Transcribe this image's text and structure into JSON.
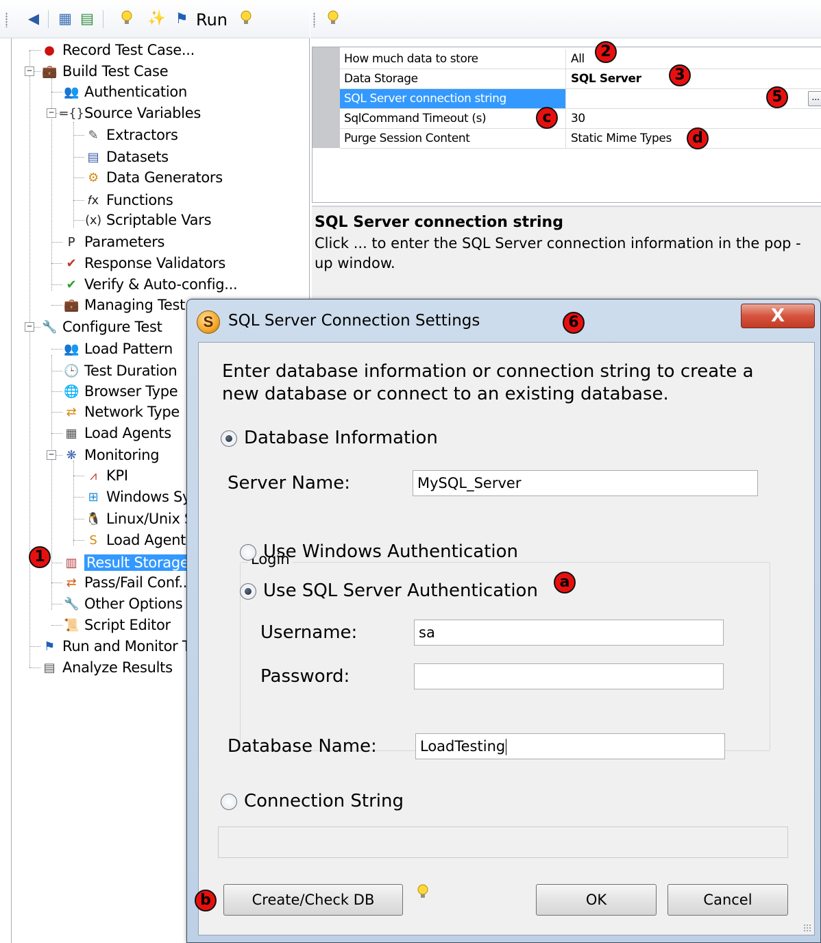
{
  "left_toolbar": {
    "buttons": [
      {
        "name": "back-icon",
        "glyph": "◆"
      },
      {
        "name": "grid-view-icon",
        "glyph": "▦"
      },
      {
        "name": "list-view-icon",
        "glyph": "▤"
      },
      {
        "name": "lightbulb-icon",
        "glyph": "💡"
      },
      {
        "name": "wand-icon",
        "glyph": "✨"
      },
      {
        "name": "flag-icon",
        "glyph": "⚑"
      }
    ],
    "run_label": "Run"
  },
  "tree": {
    "items": [
      {
        "label": "Record Test Case...",
        "icon": "record-icon",
        "glyph": "●",
        "color": "#cc1111"
      },
      {
        "label": "Build Test Case",
        "icon": "briefcase-icon",
        "glyph": "💼",
        "color": "#333333"
      },
      {
        "label": "Authentication",
        "icon": "users-icon",
        "glyph": "👥",
        "color": "#b7772a"
      },
      {
        "label": "Source Variables",
        "icon": "braces-icon",
        "glyph": "={}",
        "color": "#333333"
      },
      {
        "label": "Extractors",
        "icon": "pen-icon",
        "glyph": "✎",
        "color": "#555555"
      },
      {
        "label": "Datasets",
        "icon": "dataset-icon",
        "glyph": "▤",
        "color": "#3a5fa8"
      },
      {
        "label": "Data Generators",
        "icon": "generator-icon",
        "glyph": "⚙",
        "color": "#d48a12"
      },
      {
        "label": "Functions",
        "icon": "function-icon",
        "glyph": "𝑓x",
        "color": "#222222"
      },
      {
        "label": "Scriptable Vars",
        "icon": "variable-icon",
        "glyph": "(x)",
        "color": "#222222"
      },
      {
        "label": "Parameters",
        "icon": "parameter-icon",
        "glyph": "P",
        "color": "#222222"
      },
      {
        "label": "Response Validators",
        "icon": "validator-icon",
        "glyph": "✔",
        "color": "#c0392b"
      },
      {
        "label": "Verify & Auto-config...",
        "icon": "check-icon",
        "glyph": "✔",
        "color": "#2e9e2e"
      },
      {
        "label": "Managing Test Cases",
        "icon": "folder-icon",
        "glyph": "💼",
        "color": "#333333"
      },
      {
        "label": "Configure Test",
        "icon": "wrench-icon",
        "glyph": "🔧",
        "color": "#333333"
      },
      {
        "label": "Load Pattern",
        "icon": "load-pattern-icon",
        "glyph": "👥",
        "color": "#b33a3a"
      },
      {
        "label": "Test Duration",
        "icon": "clock-icon",
        "glyph": "🕒",
        "color": "#1f5fb8"
      },
      {
        "label": "Browser Type",
        "icon": "globe-icon",
        "glyph": "🌐",
        "color": "#1f5fb8"
      },
      {
        "label": "Network Type",
        "icon": "network-icon",
        "glyph": "⇄",
        "color": "#d48a12"
      },
      {
        "label": "Load Agents",
        "icon": "agents-icon",
        "glyph": "▦",
        "color": "#555555"
      },
      {
        "label": "Monitoring",
        "icon": "monitoring-icon",
        "glyph": "❋",
        "color": "#3a5fa8"
      },
      {
        "label": "KPI",
        "icon": "kpi-icon",
        "glyph": "⩘",
        "color": "#c0392b"
      },
      {
        "label": "Windows Systems",
        "icon": "windows-icon",
        "glyph": "⊞",
        "color": "#1f8fd8"
      },
      {
        "label": "Linux/Unix Systems",
        "icon": "linux-icon",
        "glyph": "🐧",
        "color": "#222222"
      },
      {
        "label": "Load Agents",
        "icon": "load-agent-icon",
        "glyph": "S",
        "color": "#d48a12"
      },
      {
        "label": "Result Storage",
        "icon": "storage-icon",
        "glyph": "▥",
        "color": "#b33a3a"
      },
      {
        "label": "Pass/Fail Conf...",
        "icon": "pass-fail-icon",
        "glyph": "⇄",
        "color": "#d45b12"
      },
      {
        "label": "Other Options",
        "icon": "options-icon",
        "glyph": "🔧",
        "color": "#333333"
      },
      {
        "label": "Script Editor",
        "icon": "script-icon",
        "glyph": "📜",
        "color": "#8a6a2a"
      },
      {
        "label": "Run and Monitor Test",
        "icon": "run-flag-icon",
        "glyph": "⚑",
        "color": "#1f5fb8"
      },
      {
        "label": "Analyze Results",
        "icon": "analyze-icon",
        "glyph": "▤",
        "color": "#555555"
      }
    ]
  },
  "right_toolbar": {
    "icon": "lightbulb-icon"
  },
  "properties": {
    "rows": [
      {
        "name": "How much data to store",
        "value": "All",
        "bold": false
      },
      {
        "name": "Data Storage",
        "value": "SQL Server",
        "bold": true
      },
      {
        "name": "SQL Server connection string",
        "value": "",
        "bold": false,
        "selected": true
      },
      {
        "name": "SqlCommand Timeout (s)",
        "value": "30",
        "bold": false
      },
      {
        "name": "Purge Session Content",
        "value": "Static Mime Types",
        "bold": false
      }
    ],
    "ellipsis": "..."
  },
  "help": {
    "title": "SQL Server connection string",
    "description": "Click ... to enter the SQL Server connection information in the pop -up window."
  },
  "badges": {
    "b1": "1",
    "b2": "2",
    "b3": "3",
    "b5": "5",
    "b6": "6",
    "ba": "a",
    "bb": "b",
    "bc": "c",
    "bd": "d"
  },
  "dialog": {
    "title": "SQL Server Connection Settings",
    "logo_letter": "S",
    "close": "X",
    "intro": "Enter database information or connection string to create a new database or connect to an existing database.",
    "db_info_label": "Database Information",
    "server_name_label": "Server Name:",
    "server_name_value": "MySQL_Server",
    "login_group": "Login",
    "windows_auth_label": "Use Windows Authentication",
    "sql_auth_label": "Use SQL Server Authentication",
    "username_label": "Username:",
    "username_value": "sa",
    "password_label": "Password:",
    "password_value": "",
    "database_name_label": "Database Name:",
    "database_name_value": "LoadTesting",
    "conn_string_label": "Connection String",
    "conn_string_value": "",
    "create_check_button": "Create/Check DB",
    "ok_button": "OK",
    "cancel_button": "Cancel"
  }
}
